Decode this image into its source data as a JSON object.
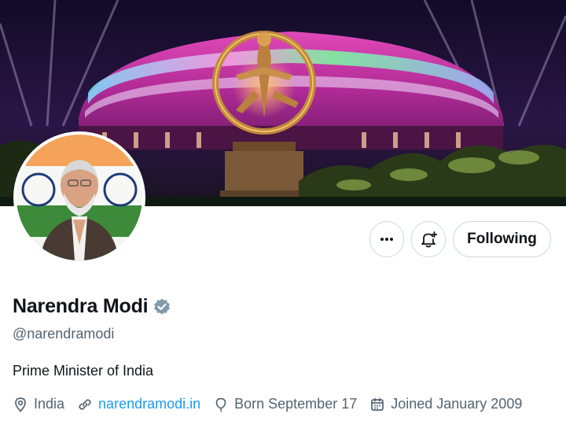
{
  "profile": {
    "display_name": "Narendra Modi",
    "handle": "@narendramodi",
    "bio": "Prime Minister of India",
    "verified": true,
    "verified_badge_color": "#829aab"
  },
  "actions": {
    "more_icon": "more-horizontal-icon",
    "notify_icon": "bell-plus-icon",
    "following_label": "Following"
  },
  "meta": {
    "location": "India",
    "website": "narendramodi.in",
    "born": "Born September 17",
    "joined": "Joined January 2009"
  },
  "colors": {
    "link": "#1d9bf0",
    "secondary_text": "#536471",
    "primary_text": "#0f1419",
    "border": "#cfd9de"
  },
  "banner": {
    "description_icon": "banner-image"
  }
}
